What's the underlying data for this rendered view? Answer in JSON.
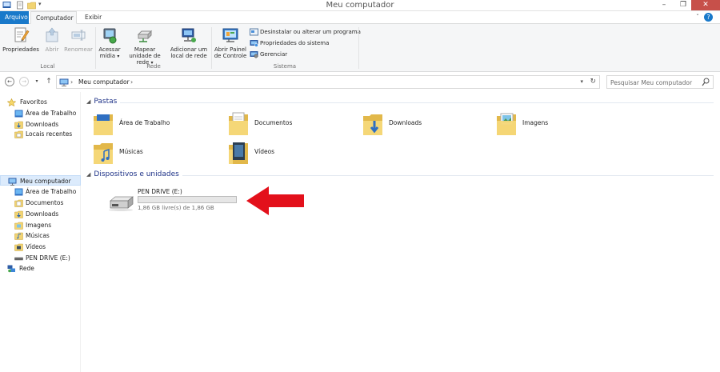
{
  "window": {
    "title": "Meu computador",
    "controls": {
      "minimize": "–",
      "maximize": "❐",
      "close": "✕"
    }
  },
  "ribbon_tabs": [
    "Arquivo",
    "Computador",
    "Exibir"
  ],
  "ribbon": {
    "local": {
      "label": "Local",
      "buttons": [
        "Propriedades",
        "Abrir",
        "Renomear"
      ]
    },
    "rede": {
      "label": "Rede",
      "buttons": [
        "Acessar mídia",
        "Mapear unidade de rede",
        "Adicionar um local de rede"
      ]
    },
    "sistema": {
      "label": "Sistema",
      "open_panel": "Abrir Painel de Controle",
      "items": [
        "Desinstalar ou alterar um programa",
        "Propriedades do sistema",
        "Gerenciar"
      ]
    }
  },
  "address": {
    "path": "Meu computador",
    "search_placeholder": "Pesquisar Meu computador"
  },
  "nav_pane": {
    "favorites_header": "Favoritos",
    "favorites": [
      "Área de Trabalho",
      "Downloads",
      "Locais recentes"
    ],
    "computer_header": "Meu computador",
    "computer_items": [
      "Área de Trabalho",
      "Documentos",
      "Downloads",
      "Imagens",
      "Músicas",
      "Vídeos",
      "PEN DRIVE (E:)"
    ],
    "network": "Rede"
  },
  "content": {
    "folders_group": "Pastas",
    "folders": [
      "Área de Trabalho",
      "Documentos",
      "Downloads",
      "Imagens",
      "Músicas",
      "Vídeos"
    ],
    "devices_group": "Dispositivos e unidades",
    "drive": {
      "name": "PEN DRIVE (E:)",
      "space": "1,86 GB livre(s) de 1,86 GB",
      "used_fraction": 0.0
    }
  },
  "colors": {
    "accent": "#1979ca",
    "group_title": "#1e3287",
    "arrow": "#e3101b",
    "folder": "#f2d472"
  }
}
